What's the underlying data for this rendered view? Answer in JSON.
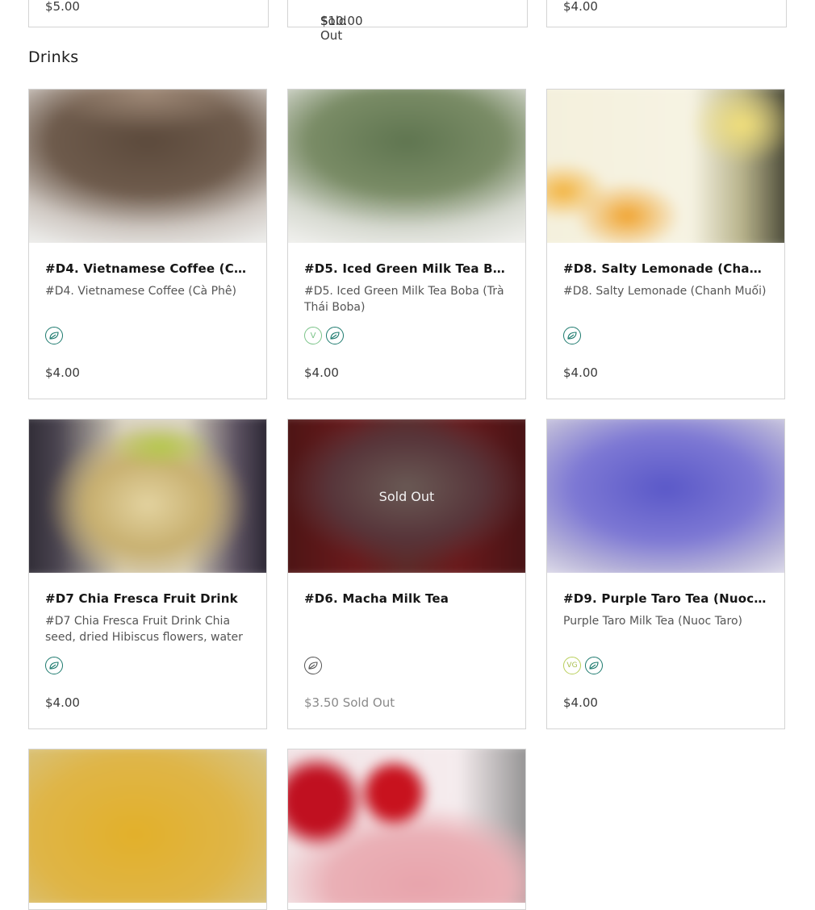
{
  "top_row": [
    {
      "price": "$5.00"
    },
    {
      "price": "$10.00",
      "status": "Sold Out"
    },
    {
      "price": "$4.00"
    }
  ],
  "section": {
    "title": "Drinks"
  },
  "items": [
    {
      "title": "#D4. Vietnamese Coffee (Cà Phê)",
      "desc": "#D4. Vietnamese Coffee (Cà Phê)",
      "price": "$4.00",
      "status": "",
      "badges": [
        "leaf-icon"
      ]
    },
    {
      "title": "#D5. Iced Green Milk Tea Boba (…",
      "desc": "#D5. Iced Green Milk Tea Boba (Trà Thái Boba)",
      "price": "$4.00",
      "status": "",
      "badges": [
        "vegetarian-v-icon",
        "leaf-icon"
      ]
    },
    {
      "title": "#D8. Salty Lemonade (Chanh M…",
      "desc": "#D8. Salty Lemonade (Chanh Muối)",
      "price": "$4.00",
      "status": "",
      "badges": [
        "leaf-icon"
      ]
    },
    {
      "title": "#D7 Chia Fresca Fruit Drink",
      "desc": "#D7 Chia Fresca Fruit Drink Chia seed, dried Hibiscus flowers, water w…",
      "price": "$4.00",
      "status": "",
      "badges": [
        "leaf-icon"
      ]
    },
    {
      "title": "#D6. Macha Milk Tea",
      "desc": "",
      "price": "$3.50",
      "status": "Sold Out",
      "overlay": "Sold Out",
      "badges": [
        "leaf-icon"
      ]
    },
    {
      "title": "#D9. Purple Taro Tea (Nuoc Taro)",
      "desc": "Purple Taro Milk Tea (Nuoc Taro)",
      "price": "$4.00",
      "status": "",
      "badges": [
        "vegan-vg-icon",
        "leaf-icon"
      ]
    }
  ],
  "badge_text": {
    "v": "V",
    "vg": "VG"
  },
  "colors": {
    "leaf": "#1d7a6e",
    "v_badge": "#7cc48a",
    "vg_badge": "#b9cf5a",
    "border": "#d4d4d4"
  }
}
